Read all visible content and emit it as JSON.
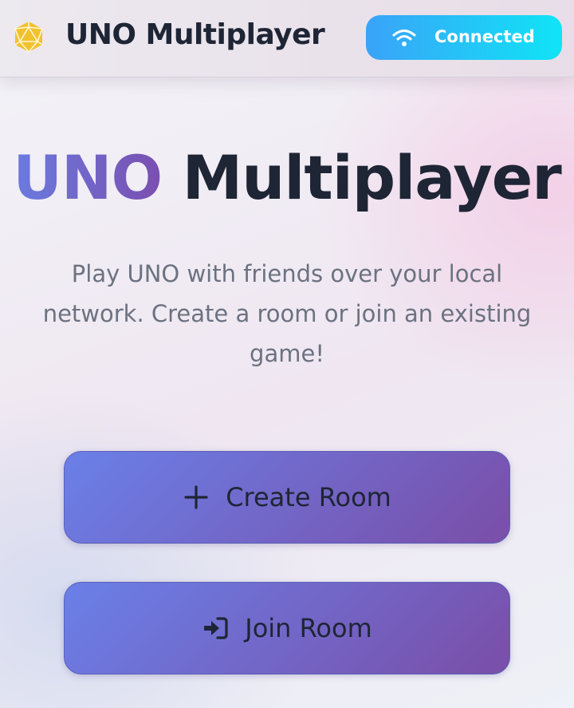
{
  "header": {
    "logo_icon": "polyhedron-icon",
    "title": "UNO Multiplayer",
    "status": {
      "icon": "wifi-icon",
      "label": "Connected",
      "colors": [
        "#3aa3f8",
        "#10e4f6"
      ]
    }
  },
  "hero": {
    "title_accent": "UNO",
    "title_rest": "Multiplayer",
    "subtitle": "Play UNO with friends over your local network. Create a room or join an existing game!"
  },
  "actions": {
    "create": {
      "icon": "plus-icon",
      "label": "Create Room"
    },
    "join": {
      "icon": "sign-in-icon",
      "label": "Join Room"
    }
  },
  "colors": {
    "logo": "#f2c12e",
    "button_gradient": [
      "#6a80e8",
      "#7a4ea8"
    ],
    "accent_gradient": [
      "#6a7be0",
      "#7a4fb0"
    ]
  }
}
